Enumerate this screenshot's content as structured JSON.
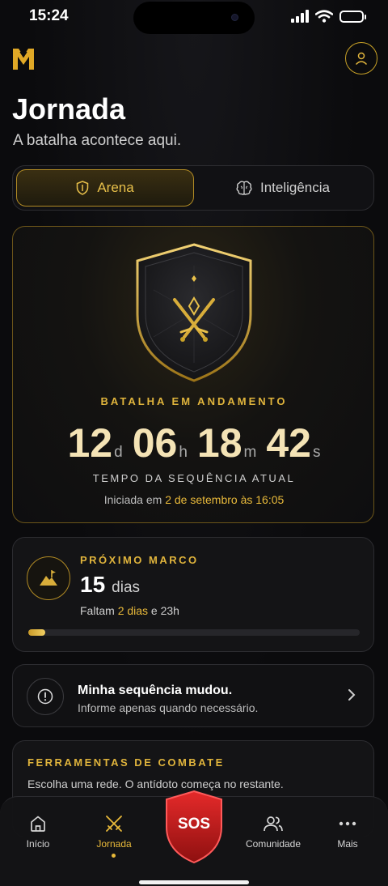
{
  "status_bar": {
    "time": "15:24"
  },
  "header": {
    "title": "Jornada",
    "subtitle": "A batalha acontece aqui."
  },
  "tabs": [
    {
      "label": "Arena",
      "icon": "shield-icon",
      "active": true
    },
    {
      "label": "Inteligência",
      "icon": "brain-icon",
      "active": false
    }
  ],
  "battle": {
    "status": "BATALHA EM ANDAMENTO",
    "timer": {
      "days": "12",
      "days_unit": "d",
      "hours": "06",
      "hours_unit": "h",
      "minutes": "18",
      "minutes_unit": "m",
      "seconds": "42",
      "seconds_unit": "s"
    },
    "timer_label": "TEMPO DA SEQUÊNCIA ATUAL",
    "started_prefix": "Iniciada em ",
    "started_date": "2 de setembro às 16:05"
  },
  "milestone": {
    "label": "PRÓXIMO MARCO",
    "value": "15",
    "unit": "dias",
    "remaining_prefix": "Faltam ",
    "remaining_value": "2 dias",
    "remaining_suffix": " e 23h",
    "progress_fraction": 0.05
  },
  "streak_changed": {
    "title": "Minha sequência mudou.",
    "subtitle": "Informe apenas quando necessário."
  },
  "tools": {
    "title": "FERRAMENTAS DE COMBATE",
    "description": "Escolha uma rede. O antídoto começa no restante."
  },
  "nav": {
    "items": [
      {
        "label": "Início",
        "icon": "home-icon",
        "active": false
      },
      {
        "label": "Jornada",
        "icon": "crossed-swords-icon",
        "active": true
      },
      {
        "label": "Comunidade",
        "icon": "community-icon",
        "active": false
      },
      {
        "label": "Mais",
        "icon": "more-icon",
        "active": false
      }
    ],
    "sos_label": "SOS"
  },
  "colors": {
    "accent_gold": "#e8b93a",
    "sos_red": "#c81e1e",
    "background": "#0b0b0d"
  }
}
